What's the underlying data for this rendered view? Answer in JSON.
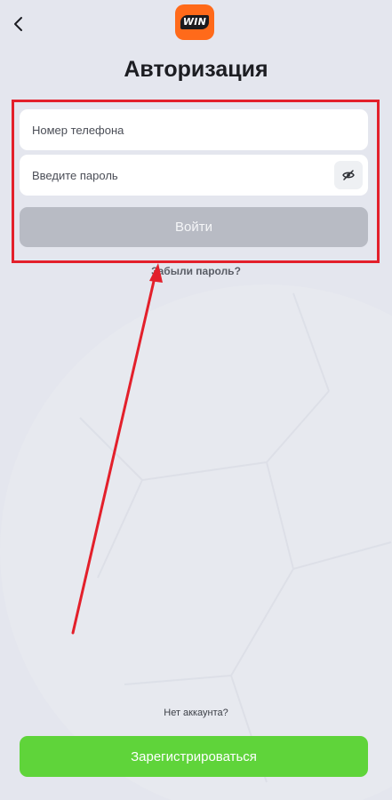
{
  "header": {
    "back_icon": "chevron-left-icon",
    "logo_text": "WIN",
    "logo_color": "#ff6a1a",
    "title": "Авторизация"
  },
  "form": {
    "phone_placeholder": "Номер телефона",
    "phone_value": "",
    "password_placeholder": "Введите пароль",
    "password_value": "",
    "password_toggle_icon": "eye-off-icon",
    "login_label": "Войти",
    "login_enabled": false,
    "forgot_password": "Забыли пароль?"
  },
  "footer": {
    "no_account": "Нет аккаунта?",
    "register_label": "Зарегистрироваться",
    "register_color": "#5fd43a"
  },
  "annotation": {
    "highlight_color": "#e3202b"
  }
}
